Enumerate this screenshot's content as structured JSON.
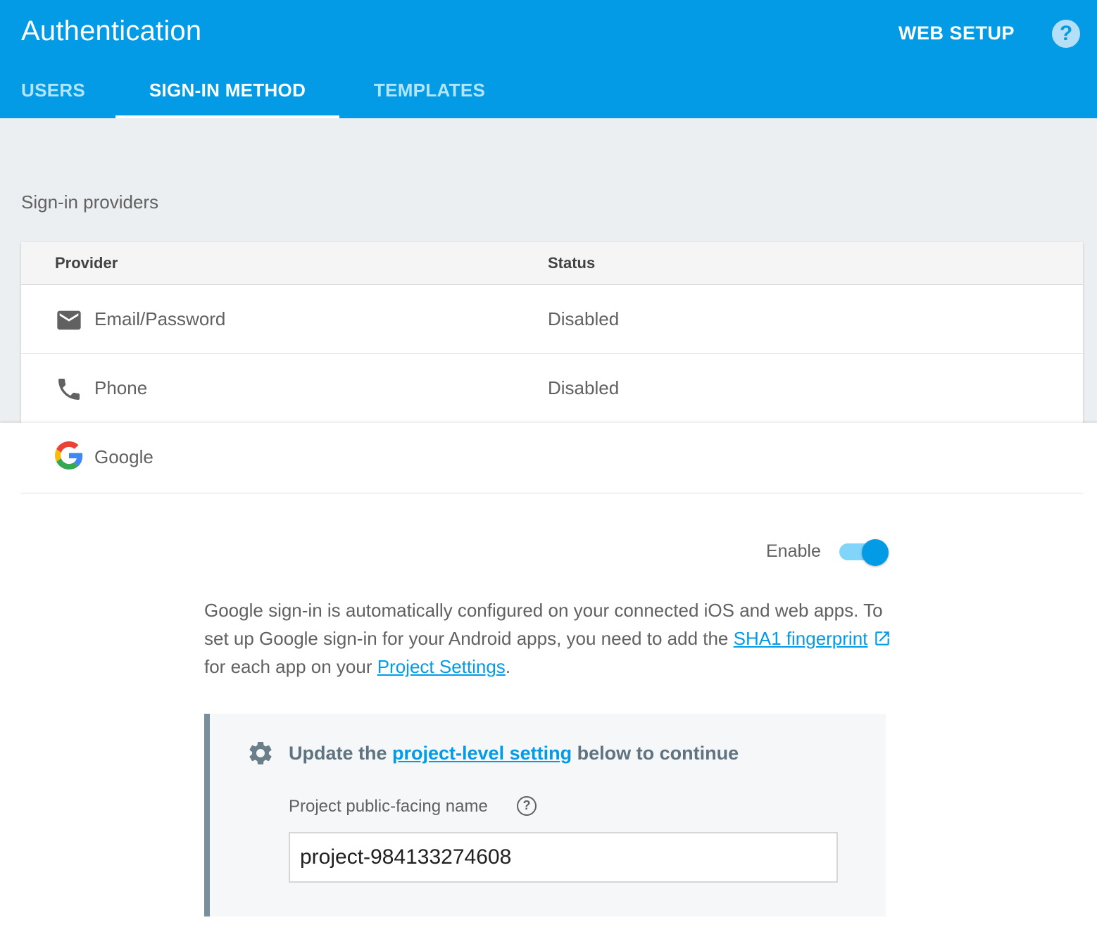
{
  "header": {
    "title": "Authentication",
    "web_setup_label": "WEB SETUP",
    "help_glyph": "?"
  },
  "tabs": [
    {
      "label": "USERS",
      "active": false
    },
    {
      "label": "SIGN-IN METHOD",
      "active": true
    },
    {
      "label": "TEMPLATES",
      "active": false
    }
  ],
  "section": {
    "title": "Sign-in providers"
  },
  "table": {
    "columns": [
      "Provider",
      "Status"
    ],
    "rows": [
      {
        "icon": "email-icon",
        "name": "Email/Password",
        "status": "Disabled"
      },
      {
        "icon": "phone-icon",
        "name": "Phone",
        "status": "Disabled"
      }
    ]
  },
  "google": {
    "icon": "google-icon",
    "name": "Google",
    "enable_label": "Enable",
    "enabled": true,
    "description": {
      "text1": "Google sign-in is automatically configured on your connected iOS and web apps. To set up Google sign-in for your Android apps, you need to add the ",
      "link1": "SHA1 fingerprint",
      "text2": " for each app on your ",
      "link2": "Project Settings",
      "text3": "."
    },
    "notice": {
      "icon": "gear-icon",
      "title_pre": "Update the ",
      "title_link": "project-level setting",
      "title_post": " below to continue",
      "field_label": "Project public-facing name",
      "field_help_glyph": "?",
      "field_value": "project-984133274608"
    }
  },
  "colors": {
    "header_bg": "#039be5",
    "page_bg": "#eceff1",
    "link": "#039be5",
    "toggle_track": "#81d4fa",
    "notice_border": "#78909c"
  }
}
